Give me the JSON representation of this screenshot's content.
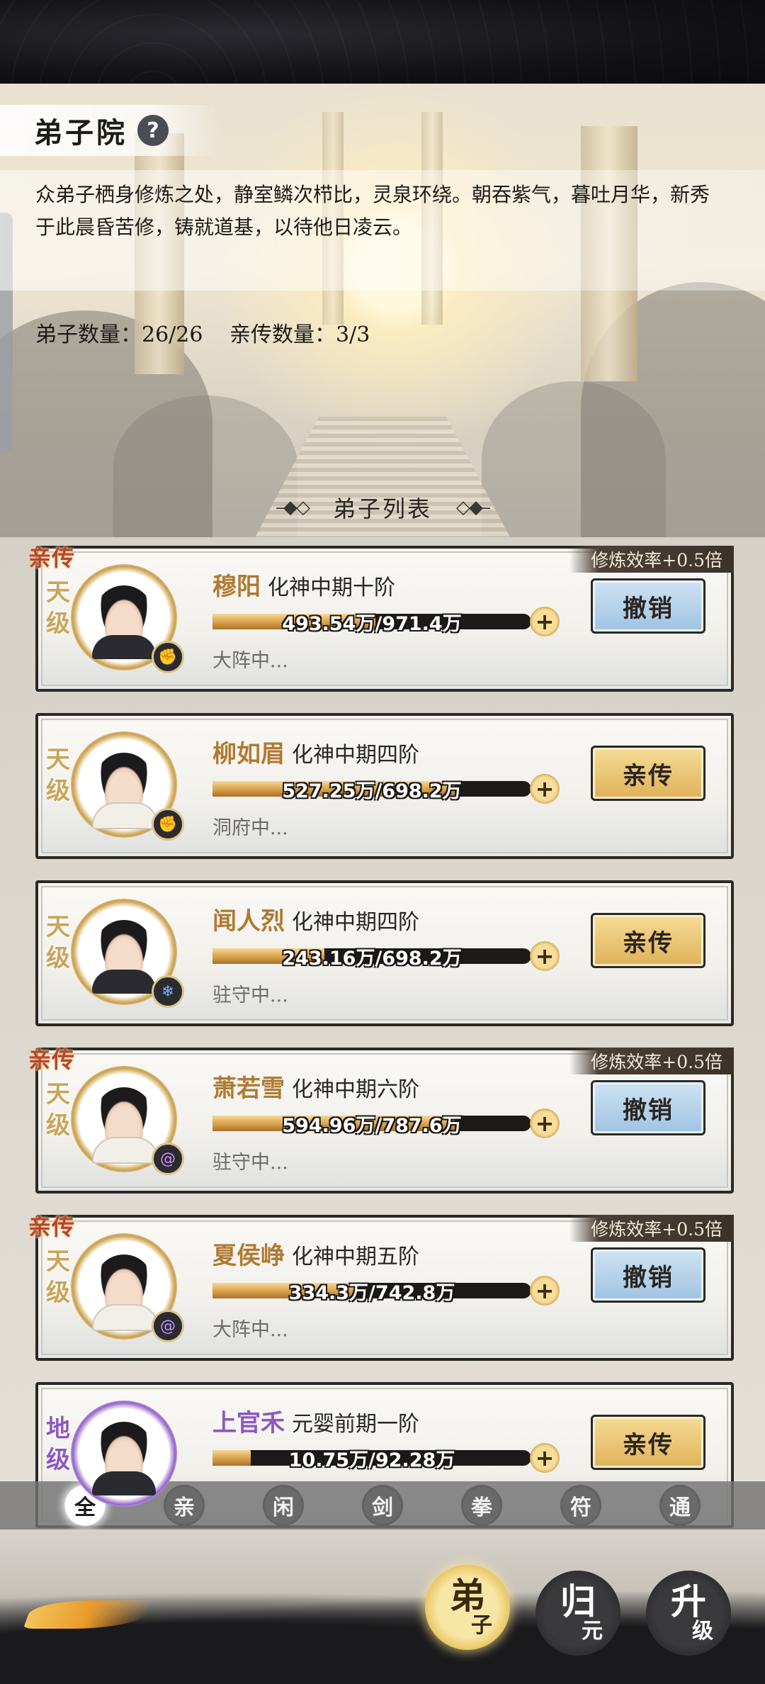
{
  "header": {
    "title": "弟子院",
    "help_icon": "?",
    "description": "众弟子栖身修炼之处，静室鳞次栉比，灵泉环绕。朝吞紫气，暮吐月华，新秀于此晨昏苦修，铸就道基，以待他日凌云。",
    "disciple_count": "弟子数量：26/26",
    "inner_count": "亲传数量：3/3"
  },
  "list": {
    "title": "弟子列表",
    "ornament_left": "–◆◇",
    "ornament_right": "◇◆–"
  },
  "disciples": [
    {
      "badge": "亲传",
      "efficiency": "修炼效率+0.5倍",
      "rank": "天级",
      "name": "穆阳",
      "realm": "化神中期十阶",
      "progress": "493.54万/971.4万",
      "fill_fraction": 0.51,
      "status": "大阵中...",
      "element_icon": "fire-fist-icon",
      "action": "撤销"
    },
    {
      "badge": "",
      "efficiency": "",
      "rank": "天级",
      "name": "柳如眉",
      "realm": "化神中期四阶",
      "progress": "527.25万/698.2万",
      "fill_fraction": 0.76,
      "status": "洞府中...",
      "element_icon": "fire-fist-icon",
      "action": "亲传"
    },
    {
      "badge": "",
      "efficiency": "",
      "rank": "天级",
      "name": "闻人烈",
      "realm": "化神中期四阶",
      "progress": "243.16万/698.2万",
      "fill_fraction": 0.35,
      "status": "驻守中...",
      "element_icon": "ice-sword-icon",
      "action": "亲传"
    },
    {
      "badge": "亲传",
      "efficiency": "修炼效率+0.5倍",
      "rank": "天级",
      "name": "萧若雪",
      "realm": "化神中期六阶",
      "progress": "594.96万/787.6万",
      "fill_fraction": 0.76,
      "status": "驻守中...",
      "element_icon": "spiral-icon",
      "action": "撤销"
    },
    {
      "badge": "亲传",
      "efficiency": "修炼效率+0.5倍",
      "rank": "天级",
      "name": "夏侯峥",
      "realm": "化神中期五阶",
      "progress": "334.3万/742.8万",
      "fill_fraction": 0.45,
      "status": "大阵中...",
      "element_icon": "spiral-icon",
      "action": "撤销"
    },
    {
      "badge": "",
      "efficiency": "",
      "rank": "地级",
      "name": "上官禾",
      "realm": "元婴前期一阶",
      "progress": "10.75万/92.28万",
      "fill_fraction": 0.12,
      "status": "",
      "element_icon": "fire-fist-icon",
      "action": "亲传"
    }
  ],
  "filters": [
    "全",
    "亲",
    "闲",
    "剑",
    "拳",
    "符",
    "通"
  ],
  "active_filter": 0,
  "bottom_nav": {
    "disciple": {
      "main": "弟",
      "sub": "子"
    },
    "guiyuan": {
      "main": "归",
      "sub": "元"
    },
    "upgrade": {
      "main": "升",
      "sub": "级"
    }
  }
}
